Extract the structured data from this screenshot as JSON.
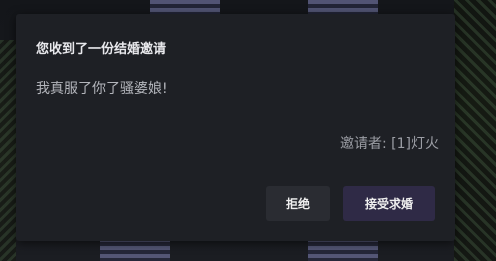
{
  "dialog": {
    "title": "您收到了一份结婚邀请",
    "message": "我真服了你了骚婆娘!",
    "inviter_label": "邀请者:",
    "inviter_name": "[1]灯火",
    "reject_label": "拒绝",
    "accept_label": "接受求婚"
  },
  "colors": {
    "dialog_bg": "#1e2025",
    "title_text": "#e8e8ec",
    "body_text": "#b3b5bb",
    "reject_bg": "#2a2c32",
    "accept_bg": "#2f2a46"
  }
}
